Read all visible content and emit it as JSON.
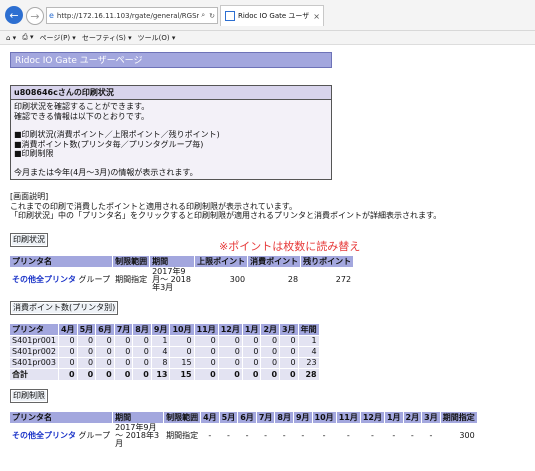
{
  "browser": {
    "url": "http://172.16.11.103/rgate/general/RGSrchPrir",
    "tab_title": "Ridoc IO Gate ユーザーペー...",
    "commands": [
      "ページ(P) ▾",
      "セーフティ(S) ▾",
      "ツール(O) ▾"
    ]
  },
  "banner": "Ridoc IO Gate ユーザーページ",
  "info": {
    "title": "u808646cさんの印刷状況",
    "lines": [
      "印刷状況を確認することができます。",
      "確認できる情報は以下のとおりです。",
      "",
      "■印刷状況(消費ポイント／上限ポイント／残りポイント)",
      "■消費ポイント数(プリンタ毎／プリンタグループ毎)",
      "■印刷制限",
      "",
      "今月または今年(4月～3月)の情報が表示されます。"
    ]
  },
  "description": {
    "heading": "[画面説明]",
    "line1": "これまでの印刷で消費したポイントと適用される印刷制限が表示されています。",
    "line2": "「印刷状況」中の「プリンタ名」をクリックすると印刷制限が適用されるプリンタと消費ポイントが詳細表示されます。"
  },
  "status_section": {
    "button": "印刷状況",
    "headers": [
      "プリンタ名",
      "制限範囲",
      "期間",
      "上限ポイント",
      "消費ポイント",
      "残りポイント"
    ],
    "row": {
      "printer": "その他全プリンタ",
      "range": "グループ",
      "period_type": "期間指定",
      "period": "2017年9月～ 2018年3月",
      "limit": "300",
      "consumed": "28",
      "remaining": "272"
    }
  },
  "note": "※ポイントは枚数に読み替え",
  "consumption_section": {
    "button": "消費ポイント数(プリンタ別)",
    "headers": [
      "プリンタ",
      "4月",
      "5月",
      "6月",
      "7月",
      "8月",
      "9月",
      "10月",
      "11月",
      "12月",
      "1月",
      "2月",
      "3月",
      "年間"
    ],
    "rows": [
      [
        "S401pr001",
        "0",
        "0",
        "0",
        "0",
        "0",
        "1",
        "0",
        "0",
        "0",
        "0",
        "0",
        "0",
        "1"
      ],
      [
        "S401pr002",
        "0",
        "0",
        "0",
        "0",
        "0",
        "4",
        "0",
        "0",
        "0",
        "0",
        "0",
        "0",
        "4"
      ],
      [
        "S401pr003",
        "0",
        "0",
        "0",
        "0",
        "0",
        "8",
        "15",
        "0",
        "0",
        "0",
        "0",
        "0",
        "23"
      ],
      [
        "合計",
        "0",
        "0",
        "0",
        "0",
        "0",
        "13",
        "15",
        "0",
        "0",
        "0",
        "0",
        "0",
        "28"
      ]
    ]
  },
  "restriction_section": {
    "button": "印刷制限",
    "headers": [
      "プリンタ名",
      "期間",
      "制限範囲",
      "4月",
      "5月",
      "6月",
      "7月",
      "8月",
      "9月",
      "10月",
      "11月",
      "12月",
      "1月",
      "2月",
      "3月",
      "期間指定"
    ],
    "row": {
      "printer": "その他全プリンタ",
      "range": "グループ",
      "period": "2017年9月～ 2018年3月",
      "scope": "期間指定",
      "months": [
        "-",
        "-",
        "-",
        "-",
        "-",
        "-",
        "-",
        "-",
        "-",
        "-",
        "-",
        "-"
      ],
      "period_limit": "300"
    }
  }
}
